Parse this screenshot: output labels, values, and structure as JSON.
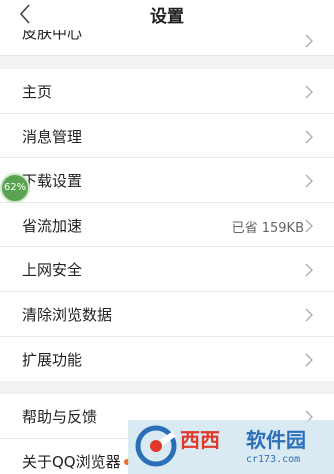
{
  "header": {
    "title": "设置"
  },
  "cut_row": {
    "label": "皮肤中心"
  },
  "group1": [
    {
      "label": "主页",
      "value": ""
    },
    {
      "label": "消息管理",
      "value": ""
    },
    {
      "label": "下载设置",
      "value": ""
    },
    {
      "label": "省流加速",
      "value": "已省 159KB"
    },
    {
      "label": "上网安全",
      "value": ""
    },
    {
      "label": "清除浏览数据",
      "value": ""
    },
    {
      "label": "扩展功能",
      "value": ""
    }
  ],
  "group2": [
    {
      "label": "帮助与反馈"
    },
    {
      "label": "关于QQ浏览器"
    }
  ],
  "badge": {
    "text": "62%"
  },
  "watermark": {
    "brand_red": "西西",
    "brand_blue": "软件园",
    "url": "cr173.com"
  },
  "colors": {
    "accent_dot": "#e8702a",
    "badge_green": "#5aa351"
  }
}
